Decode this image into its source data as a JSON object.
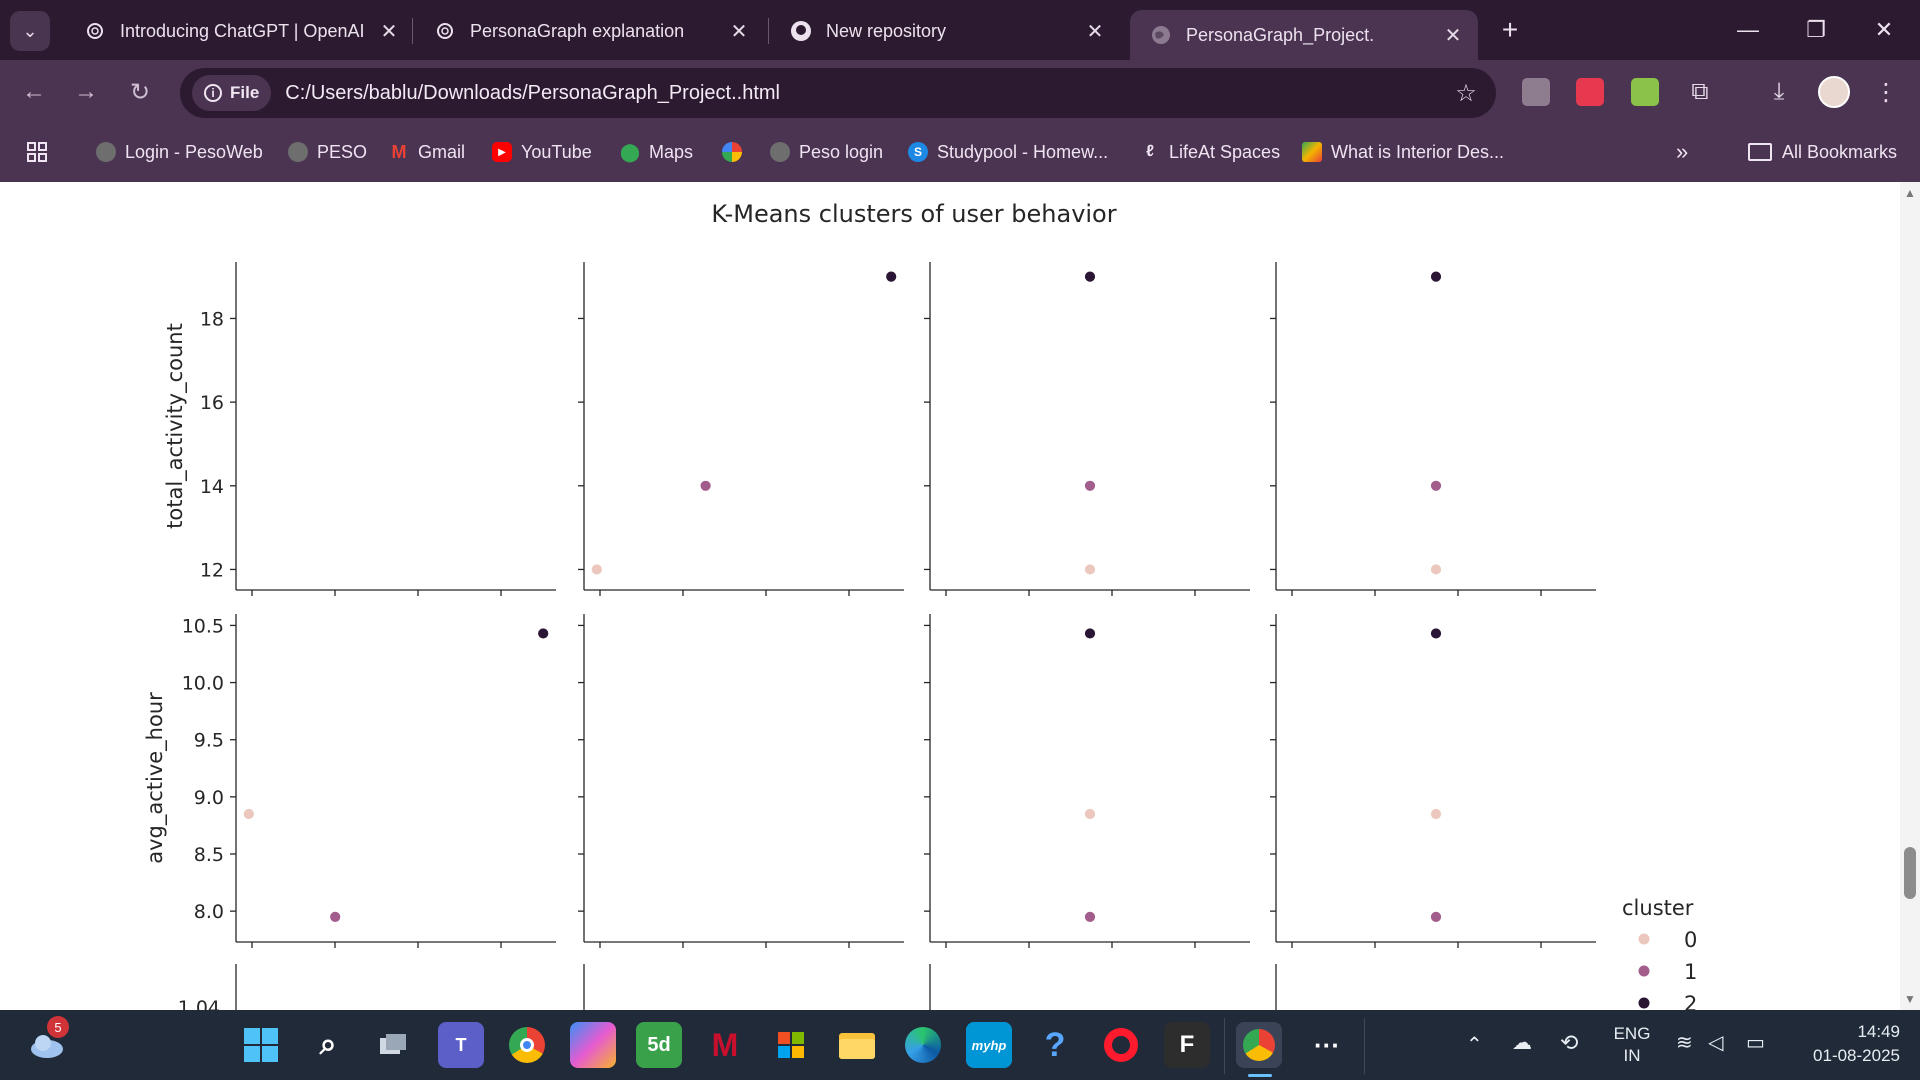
{
  "browser": {
    "tabs": [
      {
        "title": "Introducing ChatGPT | OpenAI",
        "icon": "openai-icon"
      },
      {
        "title": "PersonaGraph explanation",
        "icon": "openai-icon"
      },
      {
        "title": "New repository",
        "icon": "github-icon"
      },
      {
        "title": "PersonaGraph_Project.",
        "icon": "globe-icon"
      }
    ],
    "address": {
      "chip": "File",
      "url": "C:/Users/bablu/Downloads/PersonaGraph_Project..html"
    },
    "bookmarks": [
      {
        "label": "Login - PesoWeb",
        "color": "#6e6e6e"
      },
      {
        "label": "PESO",
        "color": "#6e6e6e"
      },
      {
        "label": "Gmail",
        "color": "#ea4335"
      },
      {
        "label": "YouTube",
        "color": "#ff0000"
      },
      {
        "label": "Maps",
        "color": "#34a853"
      },
      {
        "label": "",
        "color": "#fbbc05"
      },
      {
        "label": "Peso login",
        "color": "#6e6e6e"
      },
      {
        "label": "Studypool - Homew...",
        "color": "#1e88e5"
      },
      {
        "label": "LifeAt Spaces",
        "color": "#333333"
      },
      {
        "label": "What is Interior Des...",
        "color": "#f4b400"
      }
    ],
    "all_bookmarks": "All Bookmarks"
  },
  "chart_data": {
    "type": "scatter",
    "title": "K-Means clusters of user behavior",
    "ylabels": [
      "total_activity_count",
      "avg_active_hour"
    ],
    "ticks": {
      "total_activity_count": [
        "12",
        "14",
        "16",
        "18"
      ],
      "avg_active_hour": [
        "8.0",
        "8.5",
        "9.0",
        "9.5",
        "10.0",
        "10.5"
      ]
    },
    "partial_tick": "1.04",
    "legend": {
      "title": "cluster",
      "entries": [
        "0",
        "1",
        "2"
      ]
    },
    "cluster_colors": [
      "#ecc7bd",
      "#a35d8d",
      "#2a1634"
    ],
    "users": [
      {
        "cluster": 0,
        "total_activity_count": 12,
        "avg_active_hour": 8.85
      },
      {
        "cluster": 1,
        "total_activity_count": 14,
        "avg_active_hour": 7.95
      },
      {
        "cluster": 2,
        "total_activity_count": 19,
        "avg_active_hour": 10.43
      }
    ]
  },
  "taskbar": {
    "weather_badge": "5",
    "lang_top": "ENG",
    "lang_bottom": "IN",
    "time": "14:49",
    "date": "01-08-2025"
  }
}
